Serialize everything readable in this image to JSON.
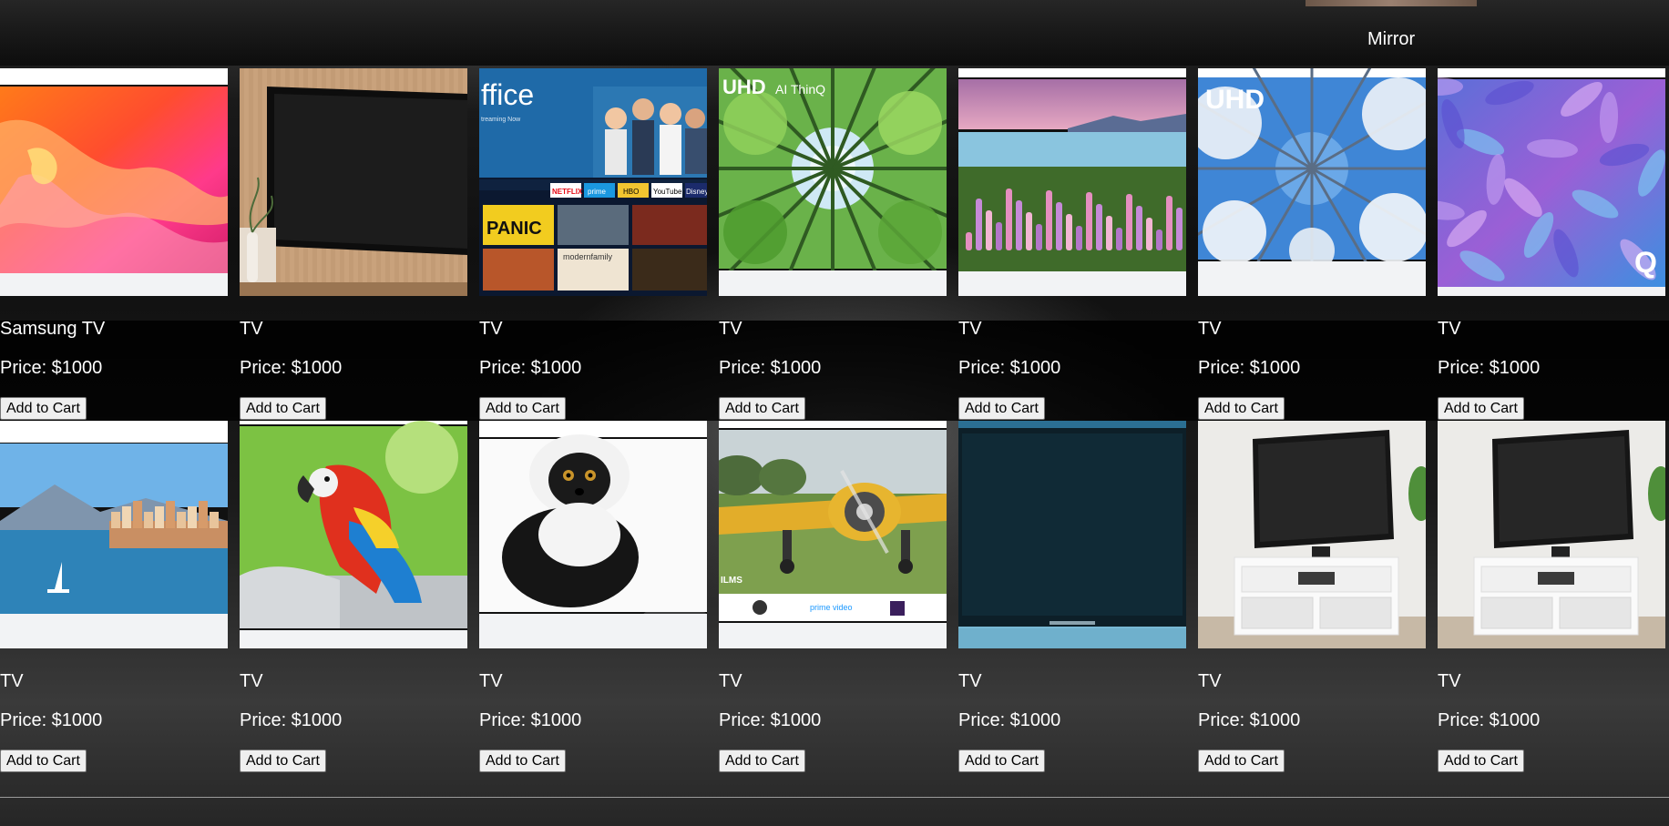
{
  "header": {
    "mirror_label": "Mirror"
  },
  "products": [
    {
      "title": "Samsung TV",
      "price": "Price: $1000",
      "button": "Add to Cart",
      "image": "canyon-screen"
    },
    {
      "title": "TV",
      "price": "Price: $1000",
      "button": "Add to Cart",
      "image": "wall-mounted-tv"
    },
    {
      "title": "TV",
      "price": "Price: $1000",
      "button": "Add to Cart",
      "image": "streaming-home-screen"
    },
    {
      "title": "TV",
      "price": "Price: $1000",
      "button": "Add to Cart",
      "image": "forest-canopy-screen"
    },
    {
      "title": "TV",
      "price": "Price: $1000",
      "button": "Add to Cart",
      "image": "lupine-lake-screen"
    },
    {
      "title": "TV",
      "price": "Price: $1000",
      "button": "Add to Cart",
      "image": "snowy-trees-screen"
    },
    {
      "title": "TV",
      "price": "Price: $1000",
      "button": "Add to Cart",
      "image": "purple-abstract-screen"
    },
    {
      "title": "TV",
      "price": "Price: $1000",
      "button": "Add to Cart",
      "image": "lakeside-town-screen"
    },
    {
      "title": "TV",
      "price": "Price: $1000",
      "button": "Add to Cart",
      "image": "macaw-screen"
    },
    {
      "title": "TV",
      "price": "Price: $1000",
      "button": "Add to Cart",
      "image": "lemur-screen"
    },
    {
      "title": "TV",
      "price": "Price: $1000",
      "button": "Add to Cart",
      "image": "airplane-screen"
    },
    {
      "title": "TV",
      "price": "Price: $1000",
      "button": "Add to Cart",
      "image": "dark-screen-tv"
    },
    {
      "title": "TV",
      "price": "Price: $1000",
      "button": "Add to Cart",
      "image": "tv-on-stand"
    },
    {
      "title": "TV",
      "price": "Price: $1000",
      "button": "Add to Cart",
      "image": "tv-on-stand"
    }
  ],
  "screen_texts": {
    "office": "ffice",
    "office_sub": "treaming Now",
    "uhd": "UHD",
    "thinq": "AI ThinQ",
    "apps": [
      "NETFLIX",
      "prime",
      "HBO",
      "YouTube",
      "Disney"
    ],
    "panic": "PANIC",
    "modern_family": "modernfamily",
    "prime_video": "prime video",
    "ilms": "ILMS",
    "q": "Q"
  }
}
